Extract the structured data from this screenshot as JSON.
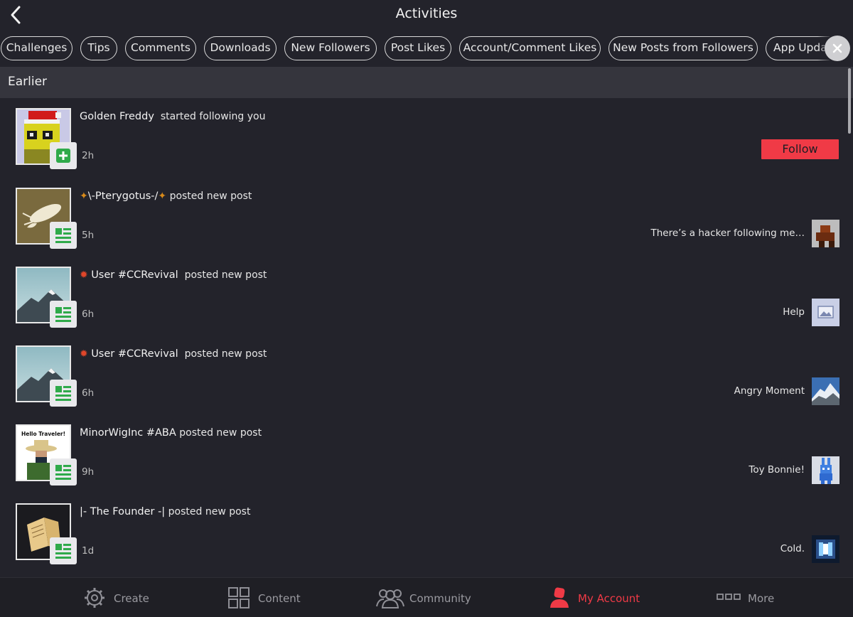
{
  "header": {
    "title": "Activities"
  },
  "filters": [
    "Challenges",
    "Tips",
    "Comments",
    "Downloads",
    "New Followers",
    "Post Likes",
    "Account/Comment Likes",
    "New Posts from Followers",
    "App Upda"
  ],
  "section": {
    "title": "Earlier"
  },
  "activities": [
    {
      "user": "Golden Freddy",
      "action": "started following you",
      "time": "2h",
      "button": "Follow"
    },
    {
      "user": "\\-Pterygotus-/",
      "action": "posted new post",
      "time": "5h",
      "post_title": "There’s a hacker following me…"
    },
    {
      "user": "User #CCRevival",
      "action": "posted new post",
      "time": "6h",
      "post_title": "Help"
    },
    {
      "user": "User #CCRevival",
      "action": "posted new post",
      "time": "6h",
      "post_title": "Angry Moment"
    },
    {
      "user": "MinorWigInc #ABA",
      "action": "posted new post",
      "time": "9h",
      "post_title": "Toy Bonnie!",
      "avatar_text": "Hello Traveler!"
    },
    {
      "user": "|- The Founder -|",
      "action": "posted new post",
      "time": "1d",
      "post_title": "Cold."
    }
  ],
  "nav": [
    {
      "label": "Create",
      "icon": "gear-icon"
    },
    {
      "label": "Content",
      "icon": "grid-icon"
    },
    {
      "label": "Community",
      "icon": "people-icon"
    },
    {
      "label": "My Account",
      "icon": "person-icon",
      "active": true
    },
    {
      "label": "More",
      "icon": "more-icon"
    }
  ],
  "colors": {
    "accent": "#f03a46",
    "background": "#23232b",
    "section": "#35353d",
    "badge_green": "#2faa4a"
  }
}
